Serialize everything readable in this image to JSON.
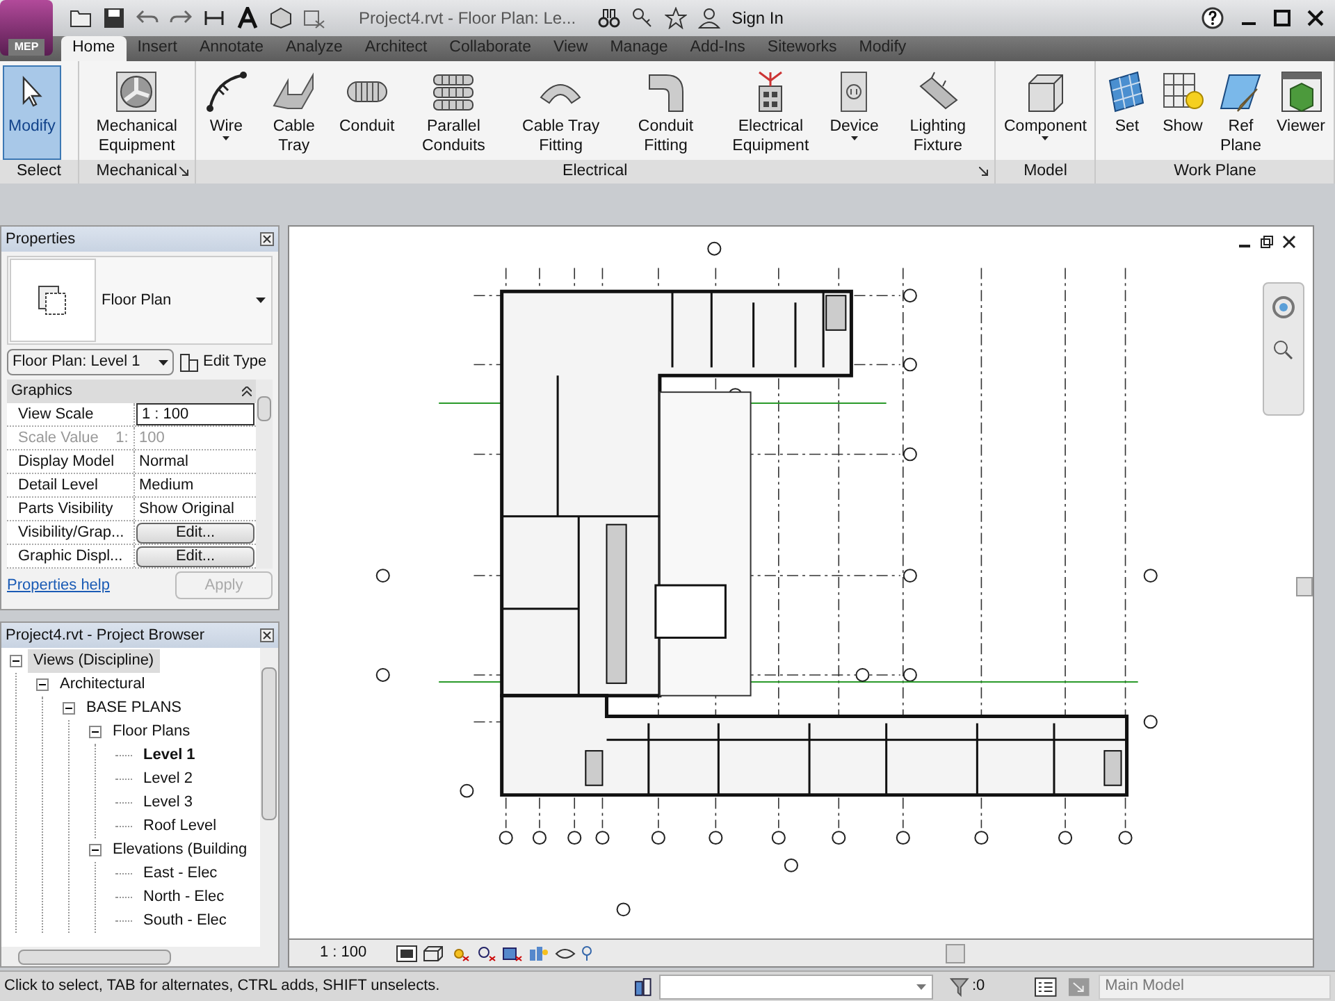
{
  "window": {
    "app_badge": "MEP",
    "title": "Project4.rvt - Floor Plan: Le...",
    "sign_in": "Sign In"
  },
  "tabs": [
    {
      "label": "Home",
      "selected": true
    },
    {
      "label": "Insert",
      "selected": false
    },
    {
      "label": "Annotate",
      "selected": false
    },
    {
      "label": "Analyze",
      "selected": false
    },
    {
      "label": "Architect",
      "selected": false
    },
    {
      "label": "Collaborate",
      "selected": false
    },
    {
      "label": "View",
      "selected": false
    },
    {
      "label": "Manage",
      "selected": false
    },
    {
      "label": "Add-Ins",
      "selected": false
    },
    {
      "label": "Siteworks",
      "selected": false
    },
    {
      "label": "Modify",
      "selected": false
    }
  ],
  "ribbon": {
    "panels": [
      {
        "label": "Select",
        "launcher": false,
        "buttons": [
          {
            "kind": "cursor",
            "label": "Modify",
            "selected": true,
            "dropdown": false
          }
        ]
      },
      {
        "label": "Mechanical",
        "launcher": true,
        "buttons": [
          {
            "kind": "fan",
            "label": "Mechanical Equipment",
            "selected": false,
            "dropdown": false
          }
        ]
      },
      {
        "label": "Electrical",
        "launcher": true,
        "buttons": [
          {
            "kind": "wire",
            "label": "Wire",
            "selected": false,
            "dropdown": true
          },
          {
            "kind": "tray",
            "label": "Cable Tray",
            "selected": false,
            "dropdown": false
          },
          {
            "kind": "conduit",
            "label": "Conduit",
            "selected": false,
            "dropdown": false
          },
          {
            "kind": "parallel",
            "label": "Parallel Conduits",
            "selected": false,
            "dropdown": false
          },
          {
            "kind": "trayfit",
            "label": "Cable Tray Fitting",
            "selected": false,
            "dropdown": false
          },
          {
            "kind": "conduitfit",
            "label": "Conduit Fitting",
            "selected": false,
            "dropdown": false
          },
          {
            "kind": "panel",
            "label": "Electrical Equipment",
            "selected": false,
            "dropdown": false
          },
          {
            "kind": "device",
            "label": "Device",
            "selected": false,
            "dropdown": true
          },
          {
            "kind": "light",
            "label": "Lighting Fixture",
            "selected": false,
            "dropdown": false
          }
        ]
      },
      {
        "label": "Model",
        "launcher": false,
        "buttons": [
          {
            "kind": "component",
            "label": "Component",
            "selected": false,
            "dropdown": true
          }
        ]
      },
      {
        "label": "Work Plane",
        "launcher": false,
        "buttons": [
          {
            "kind": "set",
            "label": "Set",
            "selected": false,
            "dropdown": false
          },
          {
            "kind": "show",
            "label": "Show",
            "selected": false,
            "dropdown": false
          },
          {
            "kind": "refplane",
            "label": "Ref Plane",
            "selected": false,
            "dropdown": false
          },
          {
            "kind": "viewer",
            "label": "Viewer",
            "selected": false,
            "dropdown": false
          }
        ]
      }
    ]
  },
  "properties": {
    "title": "Properties",
    "type_name": "Floor Plan",
    "selector": "Floor Plan: Level 1",
    "edit_type": "Edit Type",
    "group": "Graphics",
    "rows": [
      {
        "kind": "input",
        "name": "View Scale",
        "value": "1 : 100",
        "disabled": false
      },
      {
        "kind": "text",
        "name": "Scale Value    1:",
        "value": "100",
        "disabled": true
      },
      {
        "kind": "text",
        "name": "Display Model",
        "value": "Normal",
        "disabled": false
      },
      {
        "kind": "text",
        "name": "Detail Level",
        "value": "Medium",
        "disabled": false
      },
      {
        "kind": "text",
        "name": "Parts Visibility",
        "value": "Show Original",
        "disabled": false
      },
      {
        "kind": "button",
        "name": "Visibility/Grap...",
        "value": "Edit...",
        "disabled": false
      },
      {
        "kind": "button",
        "name": "Graphic Displ...",
        "value": "Edit...",
        "disabled": false
      }
    ],
    "help": "Properties help",
    "apply": "Apply",
    "apply_disabled": true
  },
  "browser": {
    "title": "Project4.rvt - Project Browser",
    "tree": [
      {
        "label": "Views (Discipline)",
        "selected": true,
        "bold": false,
        "expanded": true,
        "children": [
          {
            "label": "Architectural",
            "selected": false,
            "bold": false,
            "expanded": true,
            "children": [
              {
                "label": "BASE PLANS",
                "selected": false,
                "bold": false,
                "expanded": true,
                "children": [
                  {
                    "label": "Floor Plans",
                    "selected": false,
                    "bold": false,
                    "expanded": true,
                    "children": [
                      {
                        "label": "Level 1",
                        "selected": false,
                        "bold": true
                      },
                      {
                        "label": "Level 2",
                        "selected": false,
                        "bold": false
                      },
                      {
                        "label": "Level 3",
                        "selected": false,
                        "bold": false
                      },
                      {
                        "label": "Roof Level",
                        "selected": false,
                        "bold": false
                      }
                    ]
                  },
                  {
                    "label": "Elevations (Building",
                    "selected": false,
                    "bold": false,
                    "expanded": true,
                    "children": [
                      {
                        "label": "East - Elec",
                        "selected": false,
                        "bold": false
                      },
                      {
                        "label": "North - Elec",
                        "selected": false,
                        "bold": false
                      },
                      {
                        "label": "South - Elec",
                        "selected": false,
                        "bold": false
                      }
                    ]
                  }
                ]
              }
            ]
          }
        ]
      }
    ]
  },
  "view_bar": {
    "scale": "1 : 100"
  },
  "status_bar": {
    "message": "Click to select, TAB for alternates, CTRL adds, SHIFT unselects.",
    "filter_count": ":0",
    "model": "Main Model"
  }
}
